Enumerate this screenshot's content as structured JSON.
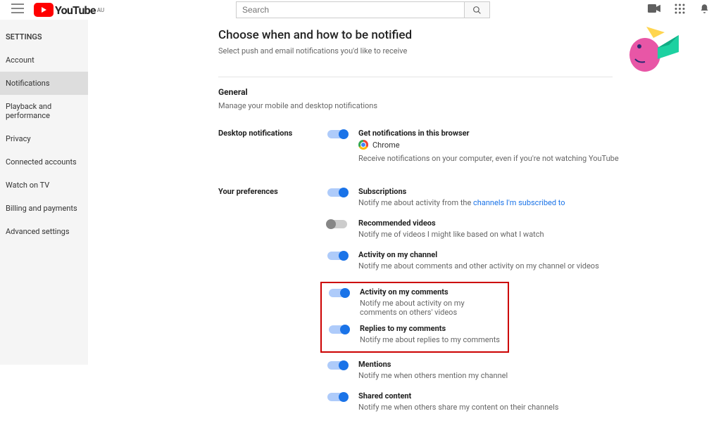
{
  "header": {
    "brand": "YouTube",
    "region": "AU",
    "search_placeholder": "Search"
  },
  "sidebar": {
    "heading": "SETTINGS",
    "items": [
      {
        "label": "Account"
      },
      {
        "label": "Notifications",
        "active": true
      },
      {
        "label": "Playback and performance"
      },
      {
        "label": "Privacy"
      },
      {
        "label": "Connected accounts"
      },
      {
        "label": "Watch on TV"
      },
      {
        "label": "Billing and payments"
      },
      {
        "label": "Advanced settings"
      }
    ]
  },
  "page": {
    "title": "Choose when and how to be notified",
    "subtitle": "Select push and email notifications you'd like to receive"
  },
  "general": {
    "title": "General",
    "subtitle": "Manage your mobile and desktop notifications"
  },
  "desktop": {
    "label": "Desktop notifications",
    "item": {
      "title": "Get notifications in this browser",
      "browser": "Chrome",
      "desc": "Receive notifications on your computer, even if you're not watching YouTube"
    }
  },
  "prefs": {
    "label": "Your preferences",
    "items": [
      {
        "title": "Subscriptions",
        "desc_pre": "Notify me about activity from the ",
        "link": "channels I'm subscribed to",
        "on": true
      },
      {
        "title": "Recommended videos",
        "desc": "Notify me of videos I might like based on what I watch",
        "on": false
      },
      {
        "title": "Activity on my channel",
        "desc": "Notify me about comments and other activity on my channel or videos",
        "on": true
      },
      {
        "title": "Activity on my comments",
        "desc": "Notify me about activity on my comments on others' videos",
        "on": true
      },
      {
        "title": "Replies to my comments",
        "desc": "Notify me about replies to my comments",
        "on": true
      },
      {
        "title": "Mentions",
        "desc": "Notify me when others mention my channel",
        "on": true
      },
      {
        "title": "Shared content",
        "desc": "Notify me when others share my content on their channels",
        "on": true
      }
    ]
  }
}
